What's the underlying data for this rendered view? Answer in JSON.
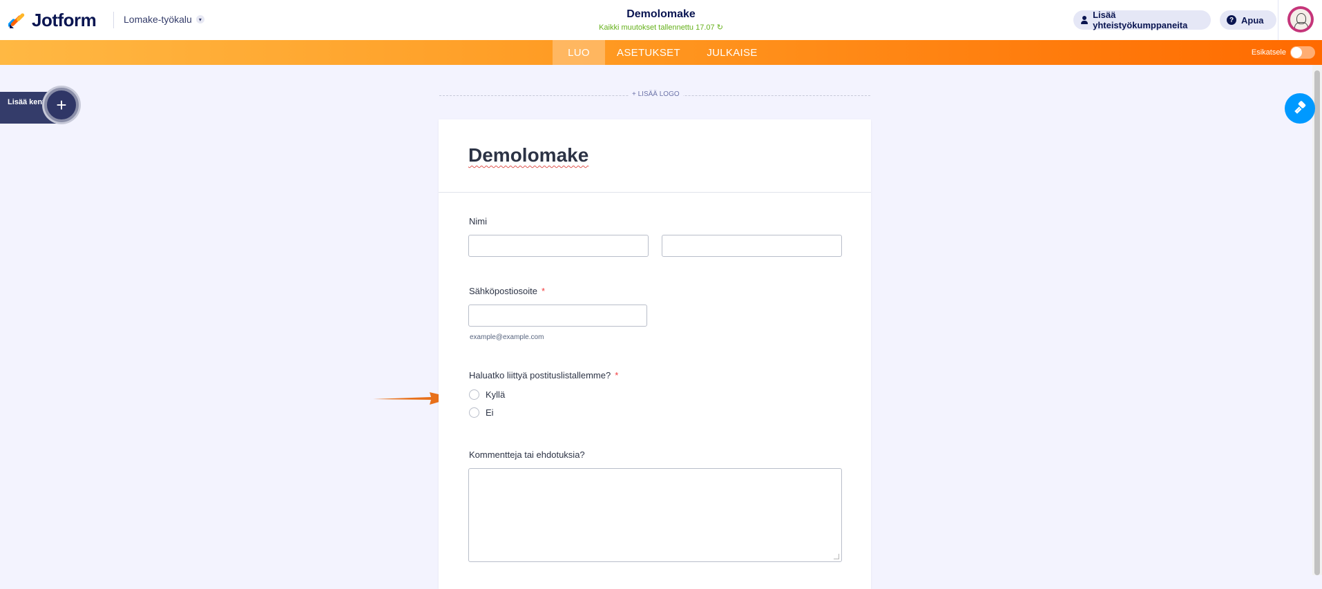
{
  "app": {
    "logo_text": "Jotform",
    "builder_label": "Lomake-työkalu"
  },
  "header": {
    "form_title": "Demolomake",
    "save_status": "Kaikki muutokset tallennettu 17.07",
    "collaborators_button": "Lisää yhteistyökumppaneita",
    "help_button": "Apua"
  },
  "nav": {
    "tabs": [
      {
        "label": "LUO",
        "active": true
      },
      {
        "label": "ASETUKSET",
        "active": false
      },
      {
        "label": "JULKAISE",
        "active": false
      }
    ],
    "preview_label": "Esikatsele",
    "preview_on": false
  },
  "sidebar": {
    "add_field_label": "Lisää kenttä"
  },
  "canvas": {
    "add_logo": "+ LISÄÄ LOGO"
  },
  "form": {
    "title": "Demolomake",
    "name_label": "Nimi",
    "email_label": "Sähköpostiosoite",
    "email_required": "*",
    "email_sublabel": "example@example.com",
    "mailing_question": "Haluatko liittyä postituslistallemme?",
    "mailing_required": "*",
    "options": [
      "Kyllä",
      "Ei"
    ],
    "comments_label": "Kommentteja tai ehdotuksia?"
  },
  "colors": {
    "brand_navy": "#0a1551",
    "nav_orange_start": "#ffb843",
    "nav_orange_end": "#ff6a00",
    "save_green": "#64b019",
    "designer_blue": "#0099ff",
    "required_red": "#f23a3c",
    "annotation_arrow": "#e8701a"
  }
}
